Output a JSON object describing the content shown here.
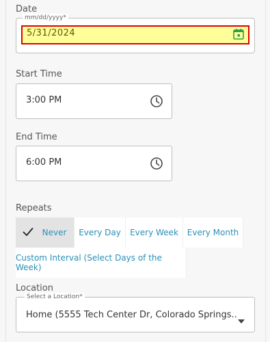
{
  "date": {
    "label": "Date",
    "legend": "mm/dd/yyyy*",
    "value": "5/31/2024",
    "icon": "calendar-icon",
    "highlight_color": "#ffff99",
    "error_border_color": "#e00000"
  },
  "start_time": {
    "label": "Start Time",
    "value": "3:00 PM",
    "icon": "clock-icon"
  },
  "end_time": {
    "label": "End Time",
    "value": "6:00 PM",
    "icon": "clock-icon"
  },
  "repeats": {
    "label": "Repeats",
    "options": [
      {
        "label": "Never",
        "selected": true
      },
      {
        "label": "Every Day",
        "selected": false
      },
      {
        "label": "Every Week",
        "selected": false
      },
      {
        "label": "Every Month",
        "selected": false
      },
      {
        "label": "Custom Interval (Select Days of the Week)",
        "selected": false
      }
    ],
    "accent": "#2a8fb8"
  },
  "location": {
    "label": "Location",
    "legend": "Select a Location*",
    "value": "Home (5555 Tech Center Dr, Colorado Springs..."
  }
}
